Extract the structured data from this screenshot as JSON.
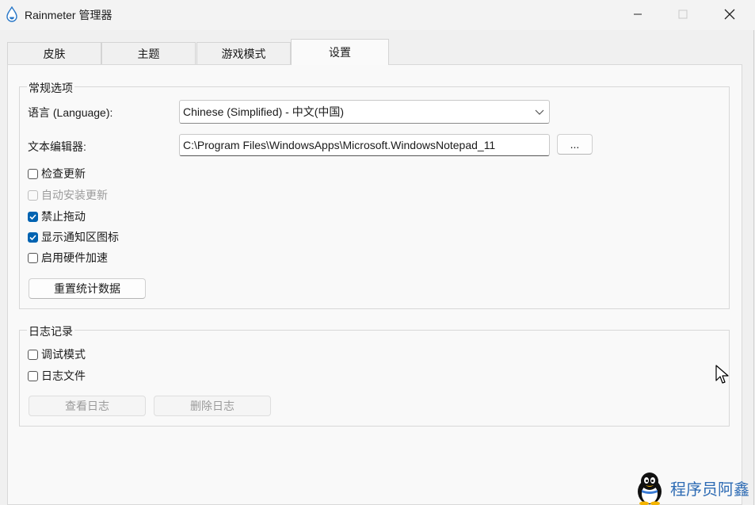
{
  "window": {
    "title": "Rainmeter 管理器",
    "icons": {
      "app": "rainmeter-drop-icon",
      "minimize": "minimize-icon",
      "maximize": "maximize-icon",
      "close": "close-icon"
    }
  },
  "tabs": [
    {
      "label": "皮肤",
      "active": false
    },
    {
      "label": "主题",
      "active": false
    },
    {
      "label": "游戏模式",
      "active": false
    },
    {
      "label": "设置",
      "active": true
    }
  ],
  "general": {
    "title": "常规选项",
    "language_label": "语言 (Language):",
    "language_value": "Chinese (Simplified) - 中文(中国)",
    "editor_label": "文本编辑器:",
    "editor_value": "C:\\Program Files\\WindowsApps\\Microsoft.WindowsNotepad_11",
    "browse_label": "...",
    "checkboxes": [
      {
        "label": "检查更新",
        "checked": false,
        "disabled": false
      },
      {
        "label": "自动安装更新",
        "checked": false,
        "disabled": true
      },
      {
        "label": "禁止拖动",
        "checked": true,
        "disabled": false
      },
      {
        "label": "显示通知区图标",
        "checked": true,
        "disabled": false
      },
      {
        "label": "启用硬件加速",
        "checked": false,
        "disabled": false
      }
    ],
    "reset_stats_label": "重置统计数据"
  },
  "logging": {
    "title": "日志记录",
    "checkboxes": [
      {
        "label": "调试模式",
        "checked": false,
        "disabled": false
      },
      {
        "label": "日志文件",
        "checked": false,
        "disabled": false
      }
    ],
    "view_log_label": "查看日志",
    "delete_log_label": "删除日志"
  },
  "watermark": {
    "text": "程序员阿鑫",
    "icon": "penguin-icon"
  },
  "colors": {
    "accent": "#0063b1",
    "watermark": "#2d6bb4"
  }
}
